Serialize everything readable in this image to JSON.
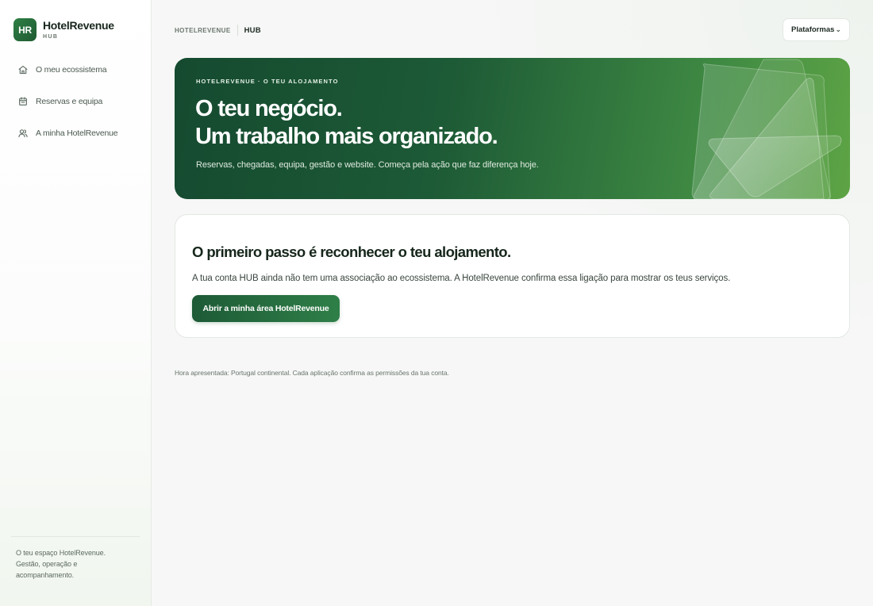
{
  "brand": {
    "logo": "HR",
    "name": "HotelRevenue",
    "sub": "HUB"
  },
  "sidebar": {
    "items": [
      {
        "label": "O meu ecossistema",
        "icon": "home-icon"
      },
      {
        "label": "Reservas e equipa",
        "icon": "calendar-icon"
      },
      {
        "label": "A minha HotelRevenue",
        "icon": "users-icon"
      }
    ],
    "footer": "O teu espaço HotelRevenue. Gestão, operação e acompanhamento."
  },
  "header": {
    "breadcrumb": [
      "HOTELREVENUE",
      "HUB"
    ],
    "platforms_label": "Plataformas",
    "platforms_icon": "chevron-down-icon"
  },
  "hero": {
    "eyebrow": "HOTELREVENUE · O TEU ALOJAMENTO",
    "title_line1": "O teu negócio.",
    "title_line2": "Um trabalho mais organizado.",
    "subtitle": "Reservas, chegadas, equipa, gestão e website. Começa pela ação que faz diferença hoje."
  },
  "card": {
    "title": "O primeiro passo é reconhecer o teu alojamento.",
    "text": "A tua conta HUB ainda não tem uma associação ao ecossistema. A HotelRevenue confirma essa ligação para mostrar os teus serviços.",
    "button_label": "Abrir a minha área HotelRevenue"
  },
  "footnote": "Hora apresentada: Portugal continental. Cada aplicação confirma as permissões da tua conta.",
  "colors": {
    "accent": "#2f7f45",
    "accent_dark": "#154a30",
    "accent_light": "#5ea445"
  }
}
